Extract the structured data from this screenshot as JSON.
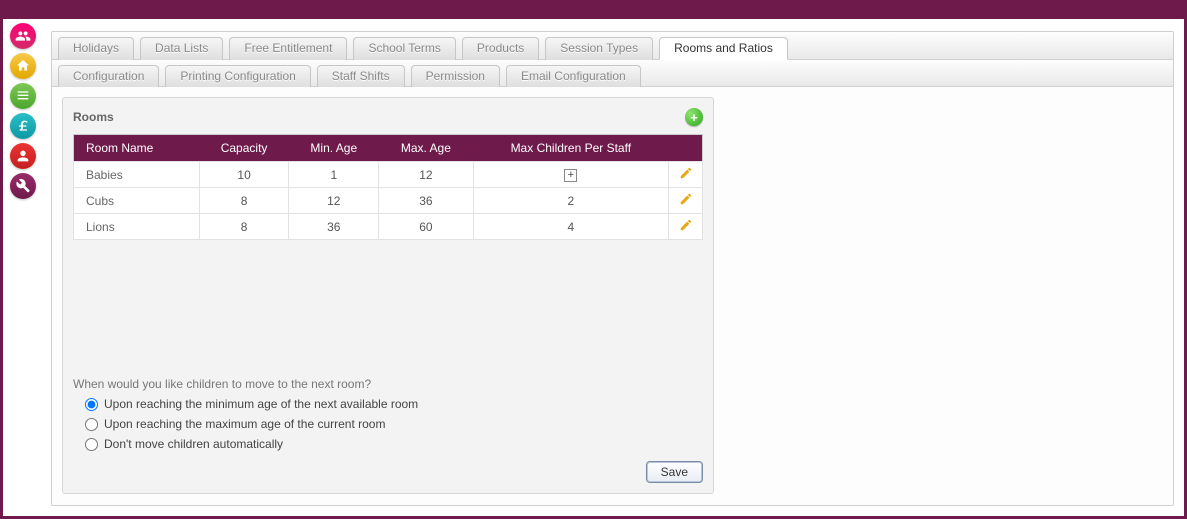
{
  "tabs_primary": [
    {
      "label": "Holidays"
    },
    {
      "label": "Data Lists"
    },
    {
      "label": "Free Entitlement"
    },
    {
      "label": "School Terms"
    },
    {
      "label": "Products"
    },
    {
      "label": "Session Types"
    },
    {
      "label": "Rooms and Ratios",
      "active": true
    }
  ],
  "tabs_secondary": [
    {
      "label": "Configuration"
    },
    {
      "label": "Printing Configuration"
    },
    {
      "label": "Staff Shifts"
    },
    {
      "label": "Permission"
    },
    {
      "label": "Email Configuration"
    }
  ],
  "panel": {
    "title": "Rooms",
    "columns": [
      "Room Name",
      "Capacity",
      "Min. Age",
      "Max. Age",
      "Max Children Per Staff"
    ],
    "rows": [
      {
        "name": "Babies",
        "capacity": "10",
        "min": "1",
        "max": "12",
        "ratio": "+"
      },
      {
        "name": "Cubs",
        "capacity": "8",
        "min": "12",
        "max": "36",
        "ratio": "2"
      },
      {
        "name": "Lions",
        "capacity": "8",
        "min": "36",
        "max": "60",
        "ratio": "4"
      }
    ],
    "move_question": "When would you like children to move to the next room?",
    "options": [
      "Upon reaching the minimum age of the next available room",
      "Upon reaching the maximum age of the current room",
      "Don't move children automatically"
    ],
    "selected_option": 0,
    "save_label": "Save"
  },
  "sidebar_icons": [
    {
      "name": "people-icon",
      "color": "c-pink"
    },
    {
      "name": "home-icon",
      "color": "c-yellow"
    },
    {
      "name": "list-icon",
      "color": "c-green"
    },
    {
      "name": "pound-icon",
      "color": "c-teal"
    },
    {
      "name": "person-icon",
      "color": "c-red"
    },
    {
      "name": "wrench-icon",
      "color": "c-purple"
    }
  ]
}
